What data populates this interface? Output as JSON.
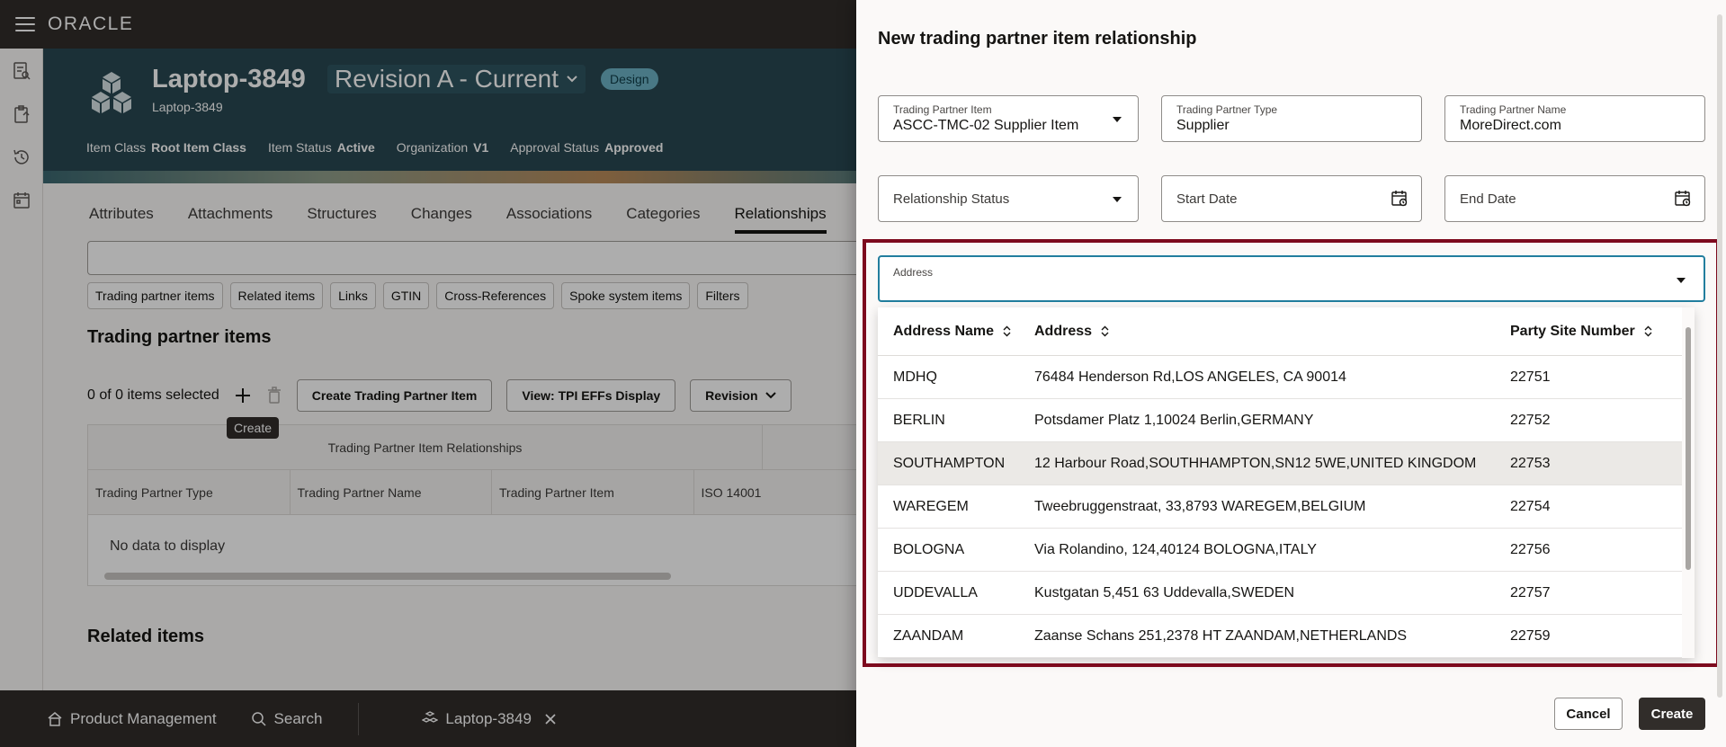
{
  "app": {
    "logo": "ORACLE"
  },
  "item": {
    "title": "Laptop-3849",
    "subtitle": "Laptop-3849",
    "revision": "Revision A - Current",
    "badge": "Design",
    "attributes": [
      {
        "label": "Item Class",
        "value": "Root Item Class"
      },
      {
        "label": "Item Status",
        "value": "Active"
      },
      {
        "label": "Organization",
        "value": "V1"
      },
      {
        "label": "Approval Status",
        "value": "Approved"
      }
    ]
  },
  "tabs": [
    "Attributes",
    "Attachments",
    "Structures",
    "Changes",
    "Associations",
    "Categories",
    "Relationships"
  ],
  "chips": [
    "Trading partner items",
    "Related items",
    "Links",
    "GTIN",
    "Cross-References",
    "Spoke system items",
    "Filters"
  ],
  "section": {
    "title": "Trading partner items",
    "selected": "0 of 0 items selected",
    "tooltip": "Create",
    "buttons": [
      "Create Trading Partner Item",
      "View: TPI EFFs Display",
      "Revision"
    ],
    "group_header": "Trading Partner Item Relationships",
    "columns": [
      "Trading Partner Type",
      "Trading Partner Name",
      "Trading Partner Item",
      "ISO 14001"
    ],
    "no_data": "No data to display",
    "related_title": "Related items"
  },
  "bottom": {
    "product": "Product Management",
    "search": "Search",
    "tab": "Laptop-3849"
  },
  "drawer": {
    "title": "New trading partner item relationship",
    "fields": {
      "tp_item": {
        "label": "Trading Partner Item",
        "value": "ASCC-TMC-02 Supplier Item"
      },
      "tp_type": {
        "label": "Trading Partner Type",
        "value": "Supplier"
      },
      "tp_name": {
        "label": "Trading Partner Name",
        "value": "MoreDirect.com"
      },
      "rel_status": {
        "label": "Relationship Status"
      },
      "start_date": {
        "label": "Start Date"
      },
      "end_date": {
        "label": "End Date"
      },
      "address": {
        "label": "Address"
      }
    },
    "dropdown": {
      "headers": [
        "Address Name",
        "Address",
        "Party Site Number"
      ],
      "rows": [
        {
          "name": "MDHQ",
          "address": "76484 Henderson Rd,LOS ANGELES, CA 90014",
          "site": "22751"
        },
        {
          "name": "BERLIN",
          "address": "Potsdamer Platz 1,10024 Berlin,GERMANY",
          "site": "22752"
        },
        {
          "name": "SOUTHAMPTON",
          "address": "12 Harbour Road,SOUTHHAMPTON,SN12 5WE,UNITED KINGDOM",
          "site": "22753"
        },
        {
          "name": "WAREGEM",
          "address": "Tweebruggenstraat, 33,8793 WAREGEM,BELGIUM",
          "site": "22754"
        },
        {
          "name": "BOLOGNA",
          "address": "Via Rolandino, 124,40124 BOLOGNA,ITALY",
          "site": "22756"
        },
        {
          "name": "UDDEVALLA",
          "address": "Kustgatan 5,451 63 Uddevalla,SWEDEN",
          "site": "22757"
        },
        {
          "name": "ZAANDAM",
          "address": "Zaanse Schans 251,2378 HT ZAANDAM,NETHERLANDS",
          "site": "22759"
        }
      ]
    },
    "cancel": "Cancel",
    "create": "Create"
  },
  "colors": {
    "highlight": "#7d0a1e",
    "focus": "#227e9e",
    "header": "#284852",
    "dark": "#312d2a"
  }
}
